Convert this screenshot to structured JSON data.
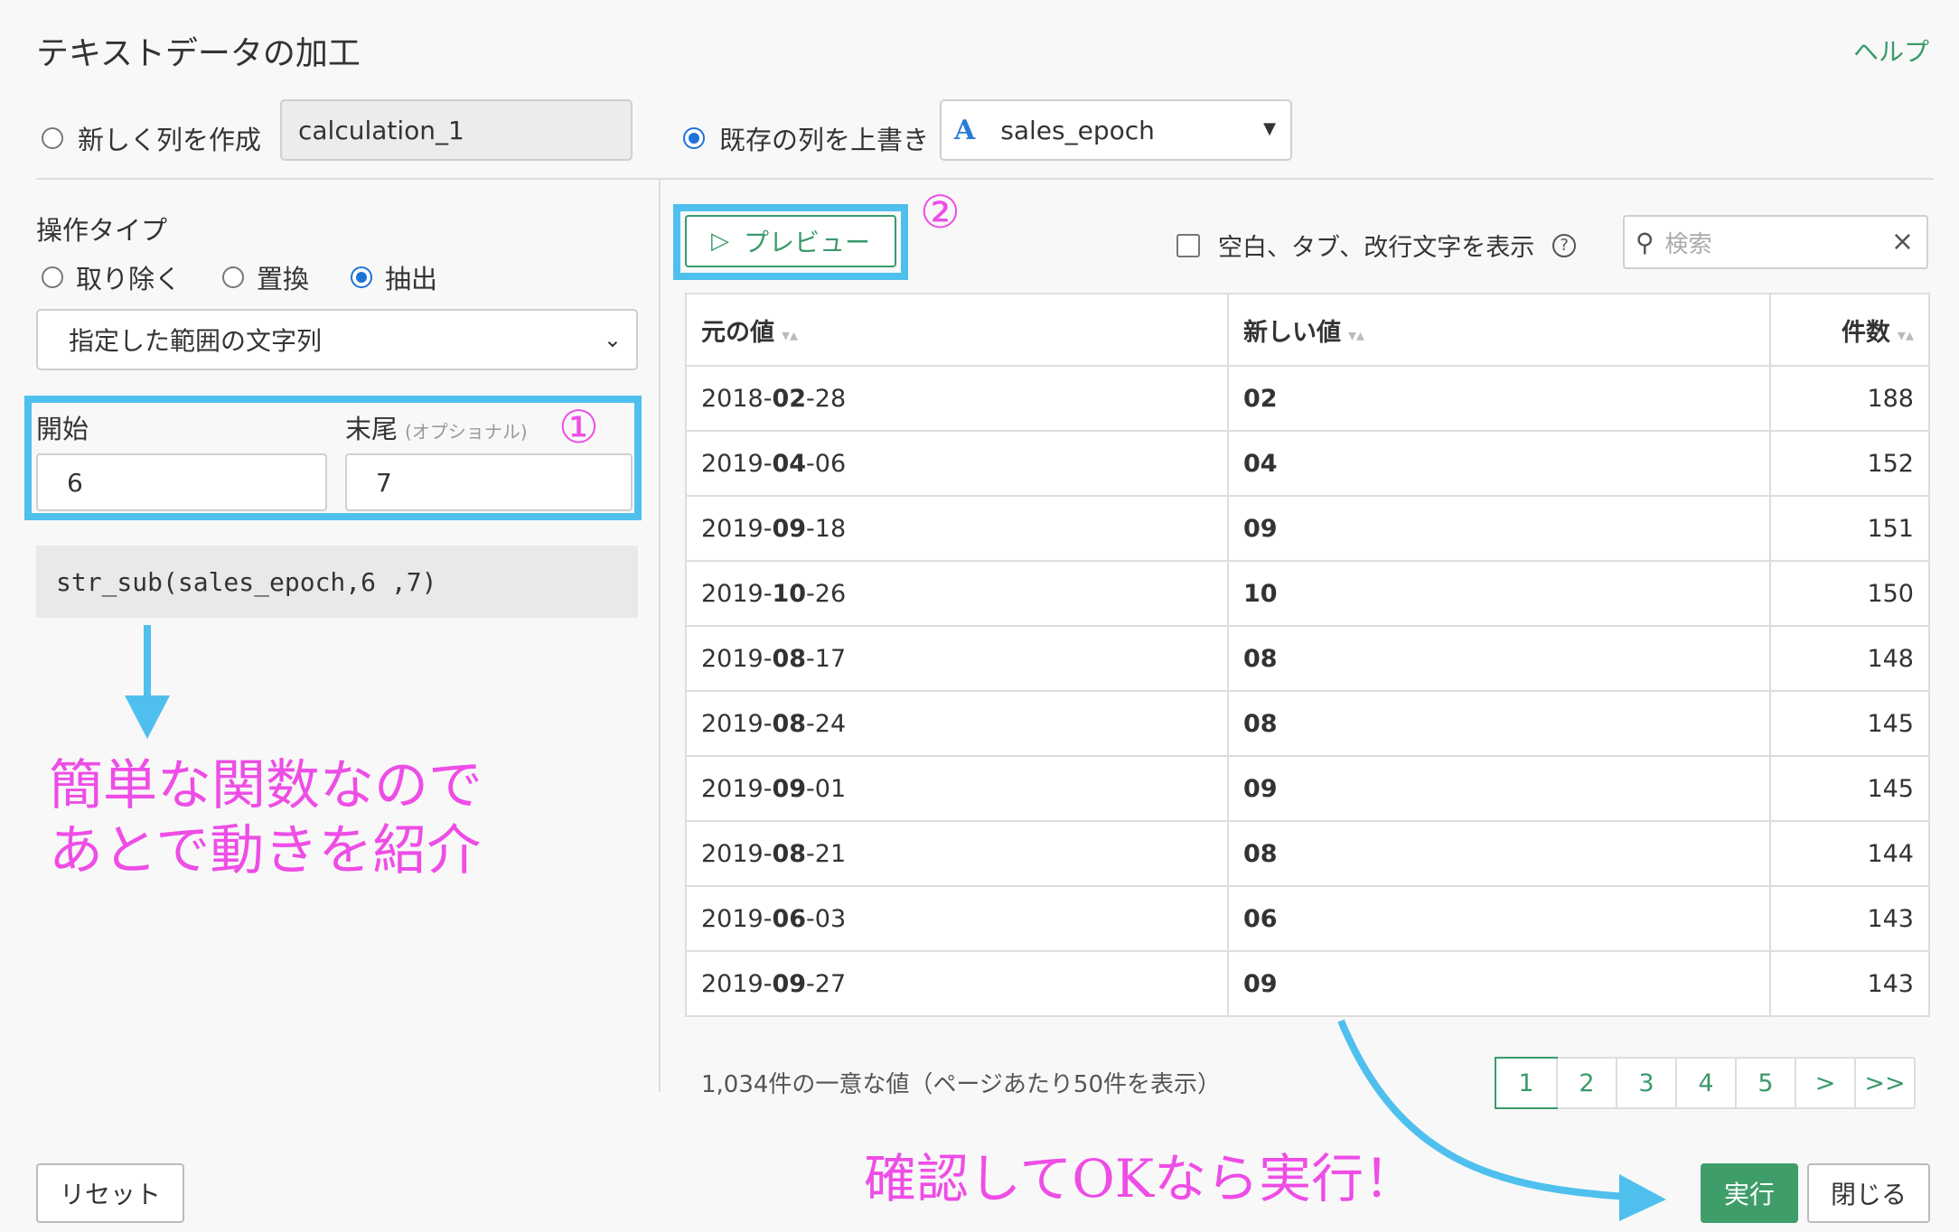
{
  "header": {
    "title": "テキストデータの加工",
    "help_label": "ヘルプ"
  },
  "output_options": {
    "new_column_label": "新しく列を作成",
    "new_column_value": "calculation_1",
    "overwrite_label": "既存の列を上書き",
    "overwrite_selected": "sales_epoch",
    "column_type_icon": "A",
    "selected_mode": "overwrite"
  },
  "left_panel": {
    "operation_type_label": "操作タイプ",
    "operation_options": [
      "取り除く",
      "置換",
      "抽出"
    ],
    "operation_selected": "抽出",
    "method_select": "指定した範囲の文字列",
    "start_label": "開始",
    "end_label": "末尾",
    "end_optional": "(オプショナル)",
    "start_value": "6",
    "end_value": "7",
    "code": "str_sub(sales_epoch,6 ,7)",
    "reset_label": "リセット"
  },
  "right_panel": {
    "preview_label": "プレビュー",
    "show_whitespace_label": "空白、タブ、改行文字を表示",
    "search_placeholder": "検索",
    "columns": [
      "元の値",
      "新しい値",
      "件数"
    ],
    "rows": [
      {
        "orig_pre": "2018-",
        "orig_bold": "02",
        "orig_post": "-28",
        "new": "02",
        "count": "188"
      },
      {
        "orig_pre": "2019-",
        "orig_bold": "04",
        "orig_post": "-06",
        "new": "04",
        "count": "152"
      },
      {
        "orig_pre": "2019-",
        "orig_bold": "09",
        "orig_post": "-18",
        "new": "09",
        "count": "151"
      },
      {
        "orig_pre": "2019-",
        "orig_bold": "10",
        "orig_post": "-26",
        "new": "10",
        "count": "150"
      },
      {
        "orig_pre": "2019-",
        "orig_bold": "08",
        "orig_post": "-17",
        "new": "08",
        "count": "148"
      },
      {
        "orig_pre": "2019-",
        "orig_bold": "08",
        "orig_post": "-24",
        "new": "08",
        "count": "145"
      },
      {
        "orig_pre": "2019-",
        "orig_bold": "09",
        "orig_post": "-01",
        "new": "09",
        "count": "145"
      },
      {
        "orig_pre": "2019-",
        "orig_bold": "08",
        "orig_post": "-21",
        "new": "08",
        "count": "144"
      },
      {
        "orig_pre": "2019-",
        "orig_bold": "06",
        "orig_post": "-03",
        "new": "06",
        "count": "143"
      },
      {
        "orig_pre": "2019-",
        "orig_bold": "09",
        "orig_post": "-27",
        "new": "09",
        "count": "143"
      }
    ],
    "summary": "1,034件の一意な値（ページあたり50件を表示）",
    "pages": [
      "1",
      "2",
      "3",
      "4",
      "5",
      ">",
      ">>"
    ],
    "active_page": "1"
  },
  "footer": {
    "run_label": "実行",
    "close_label": "閉じる"
  },
  "annotations": {
    "marker_1": "①",
    "marker_2": "②",
    "note_line1": "簡単な関数なので",
    "note_line2": "あとで動きを紹介",
    "confirm_note": "確認してOKなら実行！",
    "highlight_color": "#4fc0ee",
    "annotation_color": "#ee4de6"
  }
}
